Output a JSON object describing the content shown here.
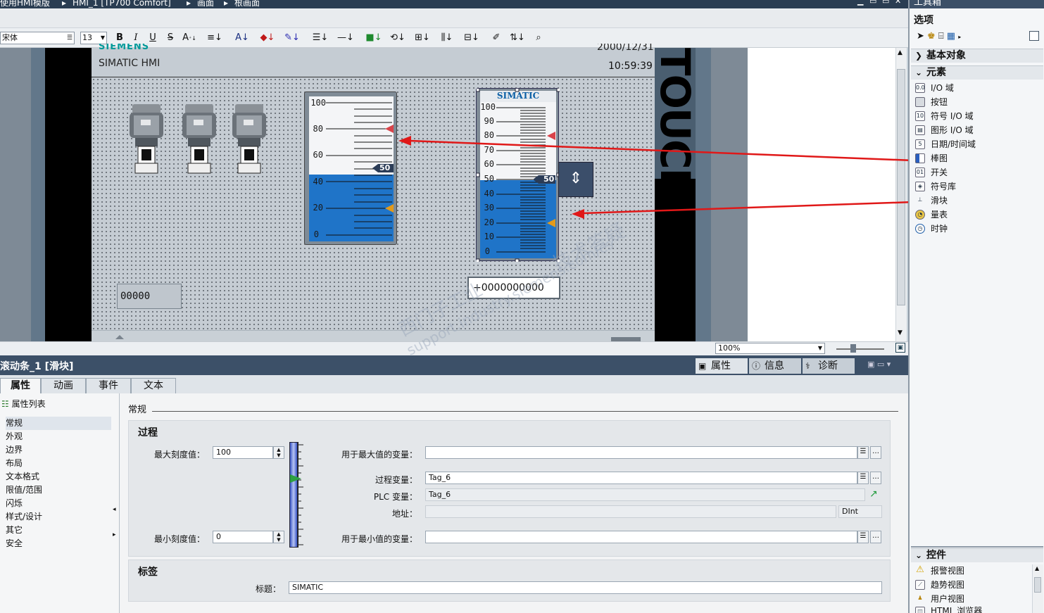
{
  "titlebar": {
    "crumb1": "使用HMI模版",
    "crumb2": "HMI_1 [TP700 Comfort]",
    "crumb3": "画面",
    "crumb4": "根画面"
  },
  "format_toolbar": {
    "font": "宋体",
    "size": "13",
    "bold": "B",
    "italic": "I",
    "underline": "U",
    "strike": "S",
    "fontsize_up": "A"
  },
  "hmi_screen": {
    "brand": "SIEMENS",
    "brand_sub": "SIMATIC HMI",
    "date": "2000/12/31",
    "time": "10:59:39",
    "touch_text": "TOUCH",
    "io_field_value": "00000",
    "slider_output_value": "+0000000000",
    "bar_scale": [
      "100",
      "80",
      "60",
      "40",
      "20",
      "0"
    ],
    "bar_value_label": "50",
    "bar_fill_fraction": 0.46,
    "slider_title": "SIMATIC",
    "slider_scale": [
      "100",
      "90",
      "80",
      "70",
      "60",
      "50",
      "40",
      "30",
      "20",
      "10",
      "0"
    ],
    "slider_value_label": "50",
    "slider_fill_fraction": 0.5
  },
  "zoom": {
    "value": "100%"
  },
  "inspector": {
    "object_title": "滚动条_1 [滑块]",
    "right_tabs": [
      "属性",
      "信息",
      "诊断"
    ],
    "tabs": [
      "属性",
      "动画",
      "事件",
      "文本"
    ],
    "list_header": "属性列表",
    "nav_items": [
      "常规",
      "外观",
      "边界",
      "布局",
      "文本格式",
      "限值/范围",
      "闪烁",
      "样式/设计",
      "其它",
      "安全"
    ],
    "section_general": "常规",
    "group_process": "过程",
    "max_scale_label": "最大刻度值：",
    "max_scale_value": "100",
    "min_scale_label": "最小刻度值：",
    "min_scale_value": "0",
    "max_var_label": "用于最大值的变量：",
    "max_var_value": "",
    "process_var_label": "过程变量：",
    "process_var_value": "Tag_6",
    "plc_var_label": "PLC 变量：",
    "plc_var_value": "Tag_6",
    "address_label": "地址：",
    "address_value": "",
    "address_type": "DInt",
    "min_var_label": "用于最小值的变量：",
    "min_var_value": "",
    "group_label": "标签",
    "title_label": "标题：",
    "title_value": "SIMATIC"
  },
  "toolbox": {
    "header": "工具箱",
    "options": "选项",
    "basic_objects": "基本对象",
    "elements": "元素",
    "element_items": [
      "I/O 域",
      "按钮",
      "符号 I/O 域",
      "图形 I/O 域",
      "日期/时间域",
      "棒图",
      "开关",
      "符号库",
      "滑块",
      "量表",
      "时钟"
    ],
    "controls": "控件",
    "control_items": [
      "报警视图",
      "趋势视图",
      "用户视图",
      "HTML 浏览器"
    ]
  },
  "watermark": {
    "line1": "西门子工业",
    "line2": "support.industry.siemens.com/cs",
    "line3": "技术答疑"
  }
}
